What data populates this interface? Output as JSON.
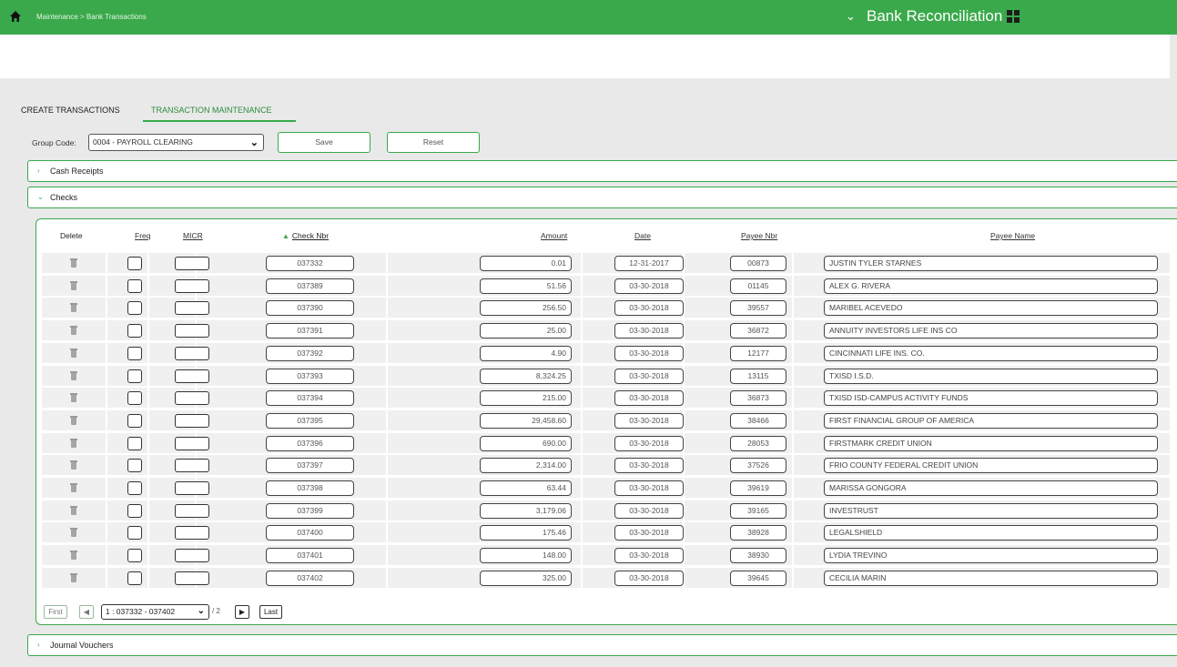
{
  "header": {
    "breadcrumb": "Maintenance > Bank Transactions",
    "app_title": "Bank Reconciliation",
    "chevron": "⌄"
  },
  "tabs": [
    {
      "label": "CREATE TRANSACTIONS"
    },
    {
      "label": "TRANSACTION MAINTENANCE",
      "active": true
    }
  ],
  "group": {
    "label": "Group Code:",
    "selected": "0004 - PAYROLL CLEARING",
    "save_label": "Save",
    "reset_label": "Reset"
  },
  "sections": {
    "cash_receipts": "Cash Receipts",
    "checks": "Checks",
    "journal_vouchers": "Journal Vouchers"
  },
  "columns": {
    "delete": "Delete",
    "freq": "Freq",
    "micr": "MICR",
    "check_nbr": "Check Nbr",
    "amount": "Amount",
    "date": "Date",
    "payee_nbr": "Payee Nbr",
    "payee_name": "Payee Name"
  },
  "rows": [
    {
      "check_nbr": "037332",
      "amount": "0.01",
      "date": "12-31-2017",
      "payee_nbr": "00873",
      "payee_name": "JUSTIN TYLER STARNES"
    },
    {
      "check_nbr": "037389",
      "amount": "51.56",
      "date": "03-30-2018",
      "payee_nbr": "01145",
      "payee_name": "ALEX G. RIVERA"
    },
    {
      "check_nbr": "037390",
      "amount": "256.50",
      "date": "03-30-2018",
      "payee_nbr": "39557",
      "payee_name": "MARIBEL ACEVEDO"
    },
    {
      "check_nbr": "037391",
      "amount": "25.00",
      "date": "03-30-2018",
      "payee_nbr": "36872",
      "payee_name": "ANNUITY INVESTORS LIFE INS CO"
    },
    {
      "check_nbr": "037392",
      "amount": "4.90",
      "date": "03-30-2018",
      "payee_nbr": "12177",
      "payee_name": "CINCINNATI LIFE INS. CO."
    },
    {
      "check_nbr": "037393",
      "amount": "8,324.25",
      "date": "03-30-2018",
      "payee_nbr": "13115",
      "payee_name": "TXISD I.S.D."
    },
    {
      "check_nbr": "037394",
      "amount": "215.00",
      "date": "03-30-2018",
      "payee_nbr": "36873",
      "payee_name": "TXISD ISD-CAMPUS ACTIVITY FUNDS"
    },
    {
      "check_nbr": "037395",
      "amount": "29,458.60",
      "date": "03-30-2018",
      "payee_nbr": "38466",
      "payee_name": "FIRST FINANCIAL GROUP OF AMERICA"
    },
    {
      "check_nbr": "037396",
      "amount": "690.00",
      "date": "03-30-2018",
      "payee_nbr": "28053",
      "payee_name": "FIRSTMARK CREDIT UNION"
    },
    {
      "check_nbr": "037397",
      "amount": "2,314.00",
      "date": "03-30-2018",
      "payee_nbr": "37526",
      "payee_name": "FRIO COUNTY FEDERAL CREDIT UNION"
    },
    {
      "check_nbr": "037398",
      "amount": "63.44",
      "date": "03-30-2018",
      "payee_nbr": "39619",
      "payee_name": "MARISSA GONGORA"
    },
    {
      "check_nbr": "037399",
      "amount": "3,179.06",
      "date": "03-30-2018",
      "payee_nbr": "39165",
      "payee_name": "INVESTRUST"
    },
    {
      "check_nbr": "037400",
      "amount": "175.46",
      "date": "03-30-2018",
      "payee_nbr": "38928",
      "payee_name": "LEGALSHIELD"
    },
    {
      "check_nbr": "037401",
      "amount": "148.00",
      "date": "03-30-2018",
      "payee_nbr": "38930",
      "payee_name": "LYDIA TREVINO"
    },
    {
      "check_nbr": "037402",
      "amount": "325.00",
      "date": "03-30-2018",
      "payee_nbr": "39645",
      "payee_name": "CECILIA MARIN"
    }
  ],
  "pager": {
    "first": "First",
    "prev": "◀",
    "range": "1 : 037332 - 037402",
    "total": "/ 2",
    "next": "▶",
    "last": "Last"
  },
  "colors": {
    "accent": "#3aa94b",
    "background": "#e9e9e9"
  },
  "icons": {
    "home": "home-icon",
    "menu": "grid-icon",
    "delete": "trash-icon"
  }
}
